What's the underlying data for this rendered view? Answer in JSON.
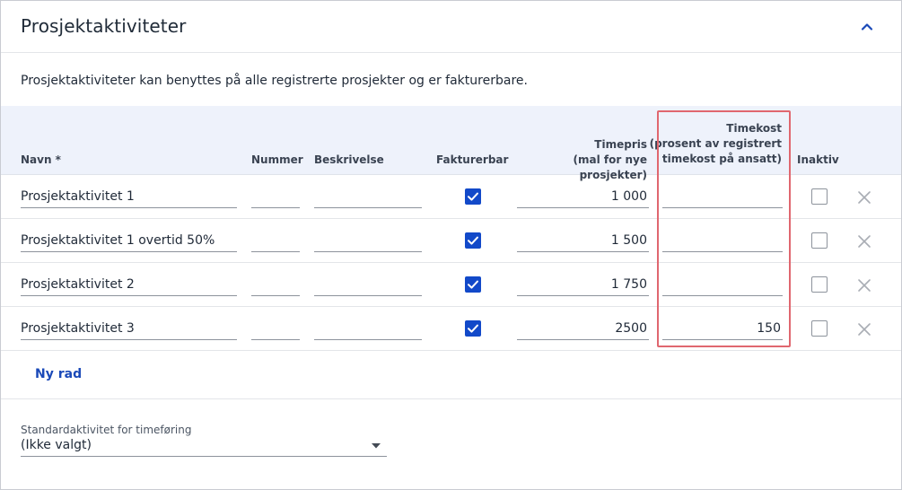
{
  "panel": {
    "title": "Prosjektaktiviteter",
    "description": "Prosjektaktiviteter kan benyttes på alle registrerte prosjekter og er fakturerbare."
  },
  "table": {
    "headers": {
      "name": "Navn *",
      "number": "Nummer",
      "description": "Beskrivelse",
      "billable": "Fakturerbar",
      "hourly_rate_line1": "Timepris",
      "hourly_rate_line2": "(mal for nye prosjekter)",
      "hourly_cost_line1": "Timekost",
      "hourly_cost_line2": "(prosent av registrert",
      "hourly_cost_line3": "timekost på ansatt)",
      "inactive": "Inaktiv"
    },
    "rows": [
      {
        "name": "Prosjektaktivitet 1",
        "number": "",
        "description": "",
        "billable": true,
        "hourly_rate": "1 000",
        "hourly_cost": "",
        "inactive": false
      },
      {
        "name": "Prosjektaktivitet 1 overtid 50%",
        "number": "",
        "description": "",
        "billable": true,
        "hourly_rate": "1 500",
        "hourly_cost": "",
        "inactive": false
      },
      {
        "name": "Prosjektaktivitet 2",
        "number": "",
        "description": "",
        "billable": true,
        "hourly_rate": "1 750",
        "hourly_cost": "",
        "inactive": false
      },
      {
        "name": "Prosjektaktivitet 3",
        "number": "",
        "description": "",
        "billable": true,
        "hourly_rate": "2500",
        "hourly_cost": "150",
        "inactive": false
      }
    ],
    "new_row_label": "Ny rad"
  },
  "default_activity": {
    "label": "Standardaktivitet for timeføring",
    "value": "(Ikke valgt)"
  },
  "icons": {
    "collapse": "chevron-up-icon",
    "checked": "check-icon",
    "delete": "close-icon",
    "dropdown": "caret-down-icon"
  },
  "colors": {
    "accent": "#1249c9",
    "link": "#1a49b8",
    "header_bg": "#eef2fb",
    "highlight": "#e0676f"
  }
}
